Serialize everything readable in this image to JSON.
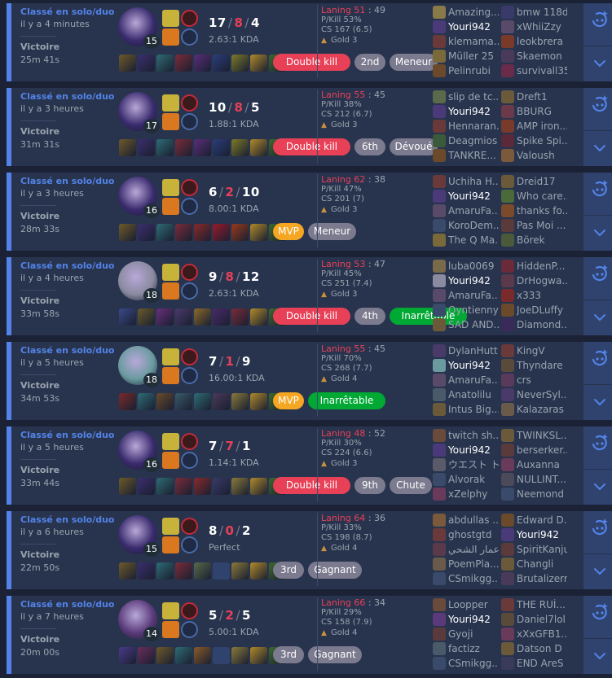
{
  "colors": {
    "win": "#5383e8",
    "loss_text": "#e84057",
    "panel": "#28344e",
    "bg": "#1c2235"
  },
  "matches": [
    {
      "queue": "Classé en solo/duo",
      "time_ago": "il y a 4 minutes",
      "result": "Victoire",
      "duration": "25m 41s",
      "champion_level": "15",
      "champ_color": "#3a2b6e",
      "kills": "17",
      "deaths": "8",
      "assists": "4",
      "kda_ratio": "2.63:1 KDA",
      "laning_label": "Laning 51",
      "laning_opp": ": 49",
      "pkill": "P/Kill 53%",
      "cs": "CS 167 (6.5)",
      "rank": "Gold 3",
      "badges": [
        {
          "text": "Double kill",
          "style": "red"
        },
        {
          "text": "2nd",
          "style": "grey"
        },
        {
          "text": "Meneur",
          "style": "grey"
        }
      ],
      "items": [
        "#6e5a2a",
        "#3b2f6e",
        "#2e6c74",
        "#7b2c3a",
        "#5a2e7b",
        "#2b3d7b",
        "#7d7a28",
        "empty-ward:#b08a2a",
        "#3c6a2a"
      ],
      "team1": [
        {
          "name": "Amazing...",
          "me": false,
          "icon": "#8a7a4a"
        },
        {
          "name": "Youri942",
          "me": true,
          "icon": "#4a3a7a"
        },
        {
          "name": "klemama...",
          "me": false,
          "icon": "#6a3a3a"
        },
        {
          "name": "Müller 25",
          "me": false,
          "icon": "#7a6a3a"
        },
        {
          "name": "Pelinrubi",
          "me": false,
          "icon": "#6a4a2a"
        }
      ],
      "team2": [
        {
          "name": "bmw 118d",
          "me": false,
          "icon": "#3a3a6a"
        },
        {
          "name": "xWhiiZzy",
          "me": false,
          "icon": "#5a4a6a"
        },
        {
          "name": "leokbrera",
          "me": false,
          "icon": "#7a3a2a"
        },
        {
          "name": "Skaemon",
          "me": false,
          "icon": "#4a3a5a"
        },
        {
          "name": "survivall35",
          "me": false,
          "icon": "#6a2a4a"
        }
      ]
    },
    {
      "queue": "Classé en solo/duo",
      "time_ago": "il y a 3 heures",
      "result": "Victoire",
      "duration": "31m 31s",
      "champion_level": "17",
      "champ_color": "#3a2b6e",
      "kills": "10",
      "deaths": "8",
      "assists": "5",
      "kda_ratio": "1.88:1 KDA",
      "laning_label": "Laning 55",
      "laning_opp": ": 45",
      "pkill": "P/Kill 38%",
      "cs": "CS 212 (6.7)",
      "rank": "Gold 3",
      "badges": [
        {
          "text": "Double kill",
          "style": "red"
        },
        {
          "text": "6th",
          "style": "grey"
        },
        {
          "text": "Dévoué",
          "style": "grey"
        }
      ],
      "items": [
        "#6e5a2a",
        "#3b2f6e",
        "#2e6c74",
        "#7b2c3a",
        "#5a2e7b",
        "#2b3d7b",
        "#7d7a28",
        "#b08a2a",
        "#3c6a2a"
      ],
      "team1": [
        {
          "name": "slip de tc...",
          "me": false,
          "icon": "#5a6a4a"
        },
        {
          "name": "Youri942",
          "me": true,
          "icon": "#4a3a7a"
        },
        {
          "name": "Hennaran...",
          "me": false,
          "icon": "#6a3a3a"
        },
        {
          "name": "Deagmios",
          "me": false,
          "icon": "#3a5a3a"
        },
        {
          "name": "TANKRE...",
          "me": false,
          "icon": "#6a4a2a"
        }
      ],
      "team2": [
        {
          "name": "Dreft1",
          "me": false,
          "icon": "#6a5a3a"
        },
        {
          "name": "BBURG",
          "me": false,
          "icon": "#6a3a4a"
        },
        {
          "name": "AMP iron...",
          "me": false,
          "icon": "#7a3a2a"
        },
        {
          "name": "Spike Spi...",
          "me": false,
          "icon": "#5a2a3a"
        },
        {
          "name": "Valoush",
          "me": false,
          "icon": "#7a5a3a"
        }
      ]
    },
    {
      "queue": "Classé en solo/duo",
      "time_ago": "il y a 3 heures",
      "result": "Victoire",
      "duration": "28m 33s",
      "champion_level": "16",
      "champ_color": "#3a2b6e",
      "kills": "6",
      "deaths": "2",
      "assists": "10",
      "kda_ratio": "8.00:1 KDA",
      "laning_label": "Laning 62",
      "laning_opp": ": 38",
      "pkill": "P/Kill 47%",
      "cs": "CS 201 (7)",
      "rank": "Gold 3",
      "badges": [
        {
          "text": "MVP",
          "style": "gold"
        },
        {
          "text": "Meneur",
          "style": "grey"
        }
      ],
      "items": [
        "#6e5a2a",
        "#3b2f6e",
        "#2e6c74",
        "#7b2c3a",
        "#8a2a2a",
        "#9a1a2a",
        "#9a3a1a",
        "#b08a2a",
        "#3c6a2a"
      ],
      "team1": [
        {
          "name": "Uchiha H...",
          "me": false,
          "icon": "#6a3a3a"
        },
        {
          "name": "Youri942",
          "me": true,
          "icon": "#4a3a7a"
        },
        {
          "name": "AmaruFa...",
          "me": false,
          "icon": "#5a4a6a"
        },
        {
          "name": "KoroDem...",
          "me": false,
          "icon": "#3a4a6a"
        },
        {
          "name": "The Q Ma...",
          "me": false,
          "icon": "#7a6a3a"
        }
      ],
      "team2": [
        {
          "name": "Dreid17",
          "me": false,
          "icon": "#6a5a3a"
        },
        {
          "name": "Who care...",
          "me": false,
          "icon": "#4a6a3a"
        },
        {
          "name": "thanks fo...",
          "me": false,
          "icon": "#7a4a2a"
        },
        {
          "name": "Pas Moi ...",
          "me": false,
          "icon": "#5a3a3a"
        },
        {
          "name": "Börek",
          "me": false,
          "icon": "#4a5a3a"
        }
      ]
    },
    {
      "queue": "Classé en solo/duo",
      "time_ago": "il y a 4 heures",
      "result": "Victoire",
      "duration": "33m 58s",
      "champion_level": "18",
      "champ_color": "#8a8aa0",
      "kills": "9",
      "deaths": "8",
      "assists": "12",
      "kda_ratio": "2.63:1 KDA",
      "laning_label": "Laning 53",
      "laning_opp": ": 47",
      "pkill": "P/Kill 45%",
      "cs": "CS 251 (7.4)",
      "rank": "Gold 3",
      "badges": [
        {
          "text": "Double kill",
          "style": "red"
        },
        {
          "text": "4th",
          "style": "grey"
        },
        {
          "text": "Inarrêtable",
          "style": "green"
        }
      ],
      "items": [
        "#3a4a8a",
        "#6a5a2a",
        "#6a2e7b",
        "#4a3a6a",
        "#8a6a2a",
        "#4a2a6a",
        "#7b2c3a",
        "#b08a2a",
        "#3c6a2a"
      ],
      "team1": [
        {
          "name": "luba0069",
          "me": false,
          "icon": "#7a6a4a"
        },
        {
          "name": "Youri942",
          "me": true,
          "icon": "#8a8aa0"
        },
        {
          "name": "AmaruFa...",
          "me": false,
          "icon": "#5a4a6a"
        },
        {
          "name": "Oyntienny",
          "me": false,
          "icon": "#3a4a6a"
        },
        {
          "name": "SAD AND...",
          "me": false,
          "icon": "#6a5a3a"
        }
      ],
      "team2": [
        {
          "name": "HiddenP...",
          "me": false,
          "icon": "#6a2a3a"
        },
        {
          "name": "DrHogwa...",
          "me": false,
          "icon": "#5a3a4a"
        },
        {
          "name": "x333",
          "me": false,
          "icon": "#7a2a2a"
        },
        {
          "name": "JoeDLuffy",
          "me": false,
          "icon": "#6a4a2a"
        },
        {
          "name": "Diamond...",
          "me": false,
          "icon": "#3a2a5a"
        }
      ]
    },
    {
      "queue": "Classé en solo/duo",
      "time_ago": "il y a 5 heures",
      "result": "Victoire",
      "duration": "34m 53s",
      "champion_level": "18",
      "champ_color": "#6a9aa0",
      "kills": "7",
      "deaths": "1",
      "assists": "9",
      "kda_ratio": "16.00:1 KDA",
      "laning_label": "Laning 55",
      "laning_opp": ": 45",
      "pkill": "P/Kill 70%",
      "cs": "CS 268 (7.7)",
      "rank": "Gold 4",
      "badges": [
        {
          "text": "MVP",
          "style": "gold"
        },
        {
          "text": "Inarrêtable",
          "style": "green"
        }
      ],
      "items": [
        "#7a2a2a",
        "#2e6c74",
        "#6a4a2a",
        "#3a5a6a",
        "#2e6c74",
        "#4a3a5a",
        "#8a7a3a",
        "#b08a2a",
        "#3c6a2a"
      ],
      "team1": [
        {
          "name": "DylanHutt",
          "me": false,
          "icon": "#4a3a6a"
        },
        {
          "name": "Youri942",
          "me": true,
          "icon": "#6a9aa0"
        },
        {
          "name": "AmaruFa...",
          "me": false,
          "icon": "#5a4a6a"
        },
        {
          "name": "Anatolilu",
          "me": false,
          "icon": "#4a5a6a"
        },
        {
          "name": "Intus Big...",
          "me": false,
          "icon": "#6a5a3a"
        }
      ],
      "team2": [
        {
          "name": "KingV",
          "me": false,
          "icon": "#6a3a3a"
        },
        {
          "name": "Thyndare",
          "me": false,
          "icon": "#5a4a3a"
        },
        {
          "name": "crs",
          "me": false,
          "icon": "#5a3a5a"
        },
        {
          "name": "NeverSyl...",
          "me": false,
          "icon": "#4a3a6a"
        },
        {
          "name": "Kalazaras",
          "me": false,
          "icon": "#6a5a4a"
        }
      ]
    },
    {
      "queue": "Classé en solo/duo",
      "time_ago": "il y a 5 heures",
      "result": "Victoire",
      "duration": "33m 44s",
      "champion_level": "16",
      "champ_color": "#3a2b6e",
      "kills": "7",
      "deaths": "7",
      "assists": "1",
      "kda_ratio": "1.14:1 KDA",
      "laning_label": "Laning 48",
      "laning_opp": ": 52",
      "pkill": "P/Kill 30%",
      "cs": "CS 224 (6.6)",
      "rank": "Gold 3",
      "badges": [
        {
          "text": "Double kill",
          "style": "red"
        },
        {
          "text": "9th",
          "style": "grey"
        },
        {
          "text": "Chute",
          "style": "grey"
        }
      ],
      "items": [
        "#6e5a2a",
        "#3b2f6e",
        "#2e6c74",
        "#7b2c3a",
        "#8a2a2a",
        "#3a3a6a",
        "#8a7a3a",
        "#b08a2a",
        "#3c6a2a"
      ],
      "team1": [
        {
          "name": "twitch sh...",
          "me": false,
          "icon": "#6a4a3a"
        },
        {
          "name": "Youri942",
          "me": true,
          "icon": "#4a3a7a"
        },
        {
          "name": "ウエスト ト...",
          "me": false,
          "icon": "#5a5a6a"
        },
        {
          "name": "Alvorak",
          "me": false,
          "icon": "#3a4a6a"
        },
        {
          "name": "xZelphy",
          "me": false,
          "icon": "#6a3a5a"
        }
      ],
      "team2": [
        {
          "name": "TWINKSL...",
          "me": false,
          "icon": "#6a5a3a"
        },
        {
          "name": "berserker...",
          "me": false,
          "icon": "#5a3a3a"
        },
        {
          "name": "Auxanna",
          "me": false,
          "icon": "#6a3a5a"
        },
        {
          "name": "NULLINT...",
          "me": false,
          "icon": "#4a4a5a"
        },
        {
          "name": "Neemond",
          "me": false,
          "icon": "#3a4a6a"
        }
      ]
    },
    {
      "queue": "Classé en solo/duo",
      "time_ago": "il y a 6 heures",
      "result": "Victoire",
      "duration": "22m 50s",
      "champion_level": "15",
      "champ_color": "#3a2b6e",
      "kills": "8",
      "deaths": "0",
      "assists": "2",
      "kda_ratio": "Perfect",
      "laning_label": "Laning 64",
      "laning_opp": ": 36",
      "pkill": "P/Kill 33%",
      "cs": "CS 198 (8.7)",
      "rank": "Gold 4",
      "badges": [
        {
          "text": "3rd",
          "style": "grey"
        },
        {
          "text": "Gagnant",
          "style": "grey"
        }
      ],
      "items": [
        "#6e5a2a",
        "#3b2f6e",
        "#2e6c74",
        "#7b2c3a",
        "#5a6a4a",
        "empty",
        "#8a7a3a",
        "#b08a2a",
        "#3c6a2a"
      ],
      "team1": [
        {
          "name": "abdullas ...",
          "me": false,
          "icon": "#7a5a3a"
        },
        {
          "name": "ghostgtd",
          "me": false,
          "icon": "#6a3a3a"
        },
        {
          "name": "عمار الشحي",
          "me": false,
          "icon": "#5a3a4a"
        },
        {
          "name": "PoemPla...",
          "me": false,
          "icon": "#6a5a4a"
        },
        {
          "name": "CSmikgg...",
          "me": false,
          "icon": "#3a4a6a"
        }
      ],
      "team2": [
        {
          "name": "Edward D...",
          "me": false,
          "icon": "#6a4a2a"
        },
        {
          "name": "Youri942",
          "me": true,
          "icon": "#4a3a7a"
        },
        {
          "name": "SpiritKanju",
          "me": false,
          "icon": "#5a3a3a"
        },
        {
          "name": "Changli",
          "me": false,
          "icon": "#6a5a3a"
        },
        {
          "name": "Brutalizerrr",
          "me": false,
          "icon": "#4a3a5a"
        }
      ]
    },
    {
      "queue": "Classé en solo/duo",
      "time_ago": "il y a 7 heures",
      "result": "Victoire",
      "duration": "20m 00s",
      "champion_level": "14",
      "champ_color": "#5a3a7a",
      "kills": "5",
      "deaths": "2",
      "assists": "5",
      "kda_ratio": "5.00:1 KDA",
      "laning_label": "Laning 66",
      "laning_opp": ": 34",
      "pkill": "P/Kill 29%",
      "cs": "CS 158 (7.9)",
      "rank": "Gold 4",
      "badges": [
        {
          "text": "3rd",
          "style": "grey"
        },
        {
          "text": "Gagnant",
          "style": "grey"
        }
      ],
      "items": [
        "#4a3a8a",
        "#6a2e5b",
        "#6e5a2a",
        "#2e6c74",
        "#8a5a2a",
        "empty",
        "#8a7a3a",
        "#b08a2a",
        "#3c6a2a"
      ],
      "team1": [
        {
          "name": "Loopper",
          "me": false,
          "icon": "#6a4a3a"
        },
        {
          "name": "Youri942",
          "me": true,
          "icon": "#5a3a7a"
        },
        {
          "name": "Gyoji",
          "me": false,
          "icon": "#5a3a3a"
        },
        {
          "name": "factizz",
          "me": false,
          "icon": "#4a5a6a"
        },
        {
          "name": "CSmikgg...",
          "me": false,
          "icon": "#3a4a6a"
        }
      ],
      "team2": [
        {
          "name": "THE RUİ...",
          "me": false,
          "icon": "#6a3a3a"
        },
        {
          "name": "Daniel7lol",
          "me": false,
          "icon": "#5a4a3a"
        },
        {
          "name": "xXxGFB1...",
          "me": false,
          "icon": "#6a3a5a"
        },
        {
          "name": "Datson D",
          "me": false,
          "icon": "#6a5a3a"
        },
        {
          "name": "END AreS",
          "me": false,
          "icon": "#3a3a5a"
        }
      ]
    }
  ]
}
